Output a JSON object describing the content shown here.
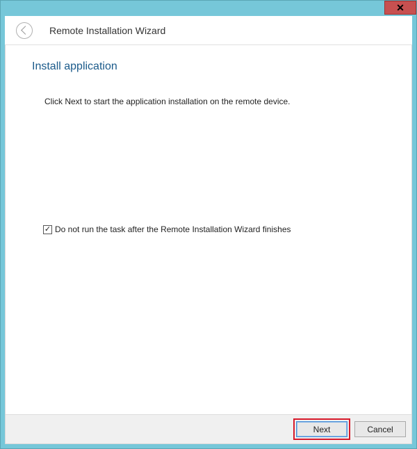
{
  "titlebar": {
    "close": "✕"
  },
  "header": {
    "title": "Remote Installation Wizard"
  },
  "page": {
    "heading": "Install application",
    "instruction": "Click Next to start the application installation on the remote device.",
    "checkbox_label": "Do not run the task after the Remote Installation Wizard finishes",
    "checkbox_checked": "✓"
  },
  "buttons": {
    "next": "Next",
    "cancel": "Cancel"
  }
}
